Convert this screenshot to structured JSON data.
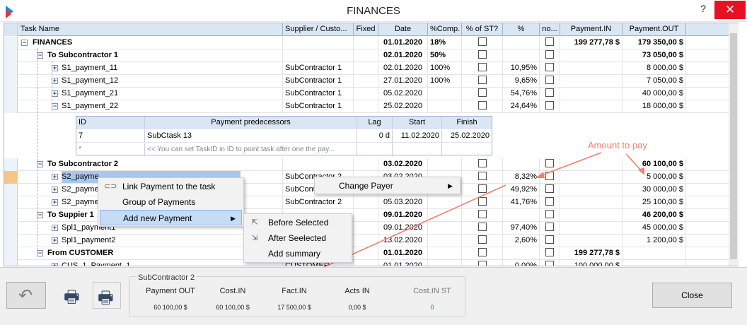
{
  "window": {
    "title": "FINANCES",
    "help": "?",
    "close": "✕"
  },
  "columns": [
    "Task Name",
    "Supplier / Custo...",
    "Fixed",
    "Date",
    "%Comp.",
    "% of ST?",
    "%",
    "no...",
    "Payment.IN",
    "Payment.OUT"
  ],
  "rows": [
    {
      "name": "FINANCES",
      "supplier": "",
      "date": "01.01.2020",
      "comp": "18%",
      "pct": "",
      "pin": "199 277,78 $",
      "pout": "179 350,00 $",
      "bold": true
    },
    {
      "name": "To Subcontractor 1",
      "supplier": "",
      "date": "02.01.2020",
      "comp": "50%",
      "pct": "",
      "pin": "",
      "pout": "73 050,00 $",
      "bold": true
    },
    {
      "name": "S1_payment_11",
      "supplier": "SubContractor 1",
      "date": "02.01.2020",
      "comp": "100%",
      "pct": "10,95%",
      "pin": "",
      "pout": "8 000,00 $"
    },
    {
      "name": "S1_payment_12",
      "supplier": "SubContractor 1",
      "date": "27.01.2020",
      "comp": "100%",
      "pct": "9,65%",
      "pin": "",
      "pout": "7 050,00 $"
    },
    {
      "name": "S1_payment_21",
      "supplier": "SubContractor 1",
      "date": "05.02.2020",
      "comp": "",
      "pct": "54,76%",
      "pin": "",
      "pout": "40 000,00 $"
    },
    {
      "name": "S1_payment_22",
      "supplier": "SubContractor 1",
      "date": "25.02.2020",
      "comp": "",
      "pct": "24,64%",
      "pin": "",
      "pout": "18 000,00 $"
    },
    {
      "name": "To Subcontractor 2",
      "supplier": "",
      "date": "03.02.2020",
      "comp": "",
      "pct": "",
      "pin": "",
      "pout": "60 100,00 $",
      "bold": true
    },
    {
      "name": "S2_payme",
      "supplier": "SubContractor 2",
      "date": "03.02.2020",
      "comp": "",
      "pct": "8,32%",
      "pin": "",
      "pout": "5 000,00 $",
      "selected": true
    },
    {
      "name": "S2_payme",
      "supplier": "SubContractor 2",
      "date": "",
      "comp": "",
      "pct": "49,92%",
      "pin": "",
      "pout": "30 000,00 $"
    },
    {
      "name": "S2_payme",
      "supplier": "SubContractor 2",
      "date": "05.03.2020",
      "comp": "",
      "pct": "41,76%",
      "pin": "",
      "pout": "25 100,00 $"
    },
    {
      "name": "To Suppier 1",
      "supplier": "",
      "date": "09.01.2020",
      "comp": "",
      "pct": "",
      "pin": "",
      "pout": "46 200,00 $",
      "bold": true
    },
    {
      "name": "Spl1_payment1",
      "supplier": "",
      "date": "09.01.2020",
      "comp": "",
      "pct": "97,40%",
      "pin": "",
      "pout": "45 000,00 $"
    },
    {
      "name": "Spl1_payment2",
      "supplier": "",
      "date": "13.02.2020",
      "comp": "",
      "pct": "2,60%",
      "pin": "",
      "pout": "1 200,00 $"
    },
    {
      "name": "From CUSTOMER",
      "supplier": "",
      "date": "01.01.2020",
      "comp": "",
      "pct": "",
      "pin": "199 277,78 $",
      "pout": "",
      "bold": true
    },
    {
      "name": "CUS_1_Payment_1",
      "supplier": "CUSTOMER",
      "date": "01.01.2020",
      "comp": "",
      "pct": "0,00%",
      "pin": "100 000,00 $",
      "pout": ""
    }
  ],
  "detail": {
    "headers": [
      "ID",
      "Payment predecessors",
      "Lag",
      "Start",
      "Finish"
    ],
    "row": {
      "id": "7",
      "pred": "SubCtask 13",
      "lag": "0 d",
      "start": "11.02.2020",
      "finish": "25.02.2020"
    },
    "new_row": {
      "id": "*",
      "hint": "<< You can set TaskID in ID to point task after one  the pay..."
    }
  },
  "context_menu": {
    "items": [
      "Link Payment to the task",
      "Group of Payments",
      "Add new Payment"
    ],
    "submenu": [
      "Before Selected",
      "After Seelected",
      "Add summary"
    ],
    "payer_item": "Change Payer"
  },
  "annotation": "Amount to pay",
  "summary": {
    "title": "SubContractor 2",
    "labels": [
      "Payment OUT",
      "Cost.IN",
      "Fact.IN",
      "Acts IN",
      "Cost.IN  ST"
    ],
    "values": [
      "60 100,00 $",
      "60 100,00 $",
      "17 500,00 $",
      "0,00 $",
      "0"
    ]
  },
  "buttons": {
    "close": "Close"
  },
  "colors": {
    "accent": "#c4dcf6",
    "header": "#dbe6f4",
    "annotation": "#f08070",
    "close_red": "#e81123"
  }
}
